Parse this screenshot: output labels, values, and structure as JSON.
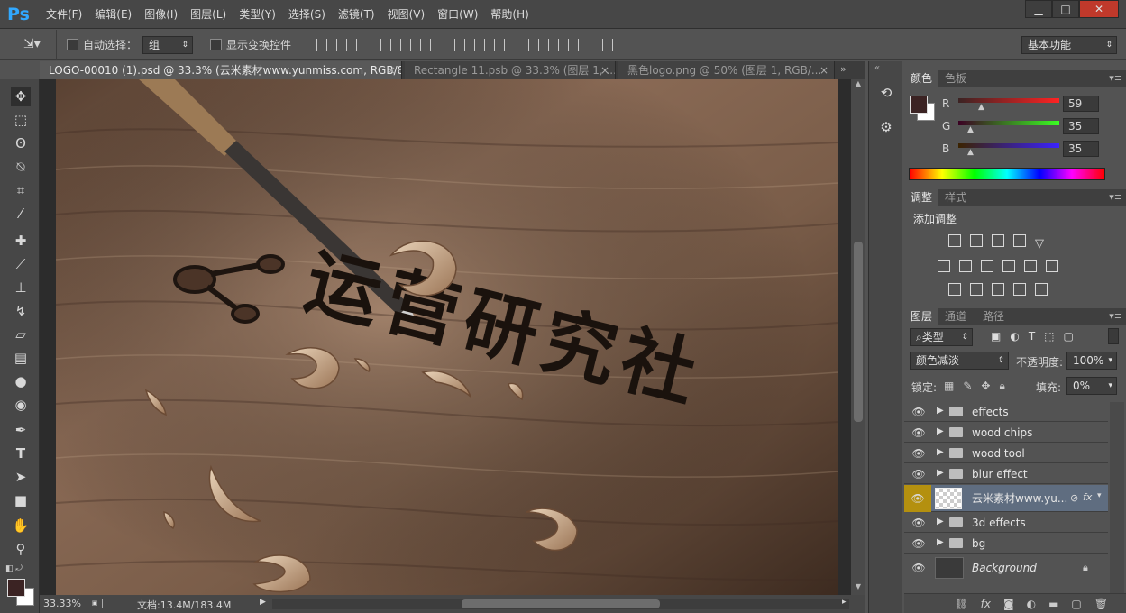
{
  "app": {
    "logo": "Ps"
  },
  "menu": [
    "文件(F)",
    "编辑(E)",
    "图像(I)",
    "图层(L)",
    "类型(Y)",
    "选择(S)",
    "滤镜(T)",
    "视图(V)",
    "窗口(W)",
    "帮助(H)"
  ],
  "window_buttons": [
    "▁",
    "□",
    "✕"
  ],
  "options": {
    "auto_select_label": "自动选择：",
    "auto_select_value": "组",
    "show_transform_label": "显示变换控件",
    "workspace": "基本功能"
  },
  "tabs": [
    {
      "title": "LOGO-00010 (1).psd @ 33.3% (云米素材www.yunmiss.com, RGB/8) *",
      "close": "×"
    },
    {
      "title": "Rectangle 11.psb @ 33.3% (图层 1, ...",
      "close": "×"
    },
    {
      "title": "黑色logo.png @ 50% (图层 1, RGB/...",
      "close": "×"
    }
  ],
  "artwork": {
    "logo_text": "运营研究社"
  },
  "status": {
    "zoom": "33.33%",
    "doc": "文档:13.4M/183.4M"
  },
  "color_panel": {
    "tabs": [
      "颜色",
      "色板"
    ],
    "channels": [
      {
        "label": "R",
        "value": "59"
      },
      {
        "label": "G",
        "value": "35"
      },
      {
        "label": "B",
        "value": "35"
      }
    ],
    "foreground": "#3b2323",
    "background": "#ffffff"
  },
  "adjust_panel": {
    "tabs": [
      "调整",
      "样式"
    ],
    "title": "添加调整"
  },
  "layers_panel": {
    "tabs": [
      "图层",
      "通道",
      "路径"
    ],
    "filter": "类型",
    "blend_mode": "颜色减淡",
    "opacity_label": "不透明度:",
    "opacity": "100%",
    "lock_label": "锁定:",
    "fill_label": "填充:",
    "fill": "0%",
    "layers": [
      {
        "name": "effects",
        "type": "group"
      },
      {
        "name": "wood chips",
        "type": "group"
      },
      {
        "name": "wood tool",
        "type": "group"
      },
      {
        "name": "blur effect",
        "type": "group"
      },
      {
        "name": "云米素材www.yu...",
        "type": "smart",
        "selected": true
      },
      {
        "name": "3d effects",
        "type": "group"
      },
      {
        "name": "bg",
        "type": "group"
      },
      {
        "name": "Background",
        "type": "background"
      }
    ]
  }
}
